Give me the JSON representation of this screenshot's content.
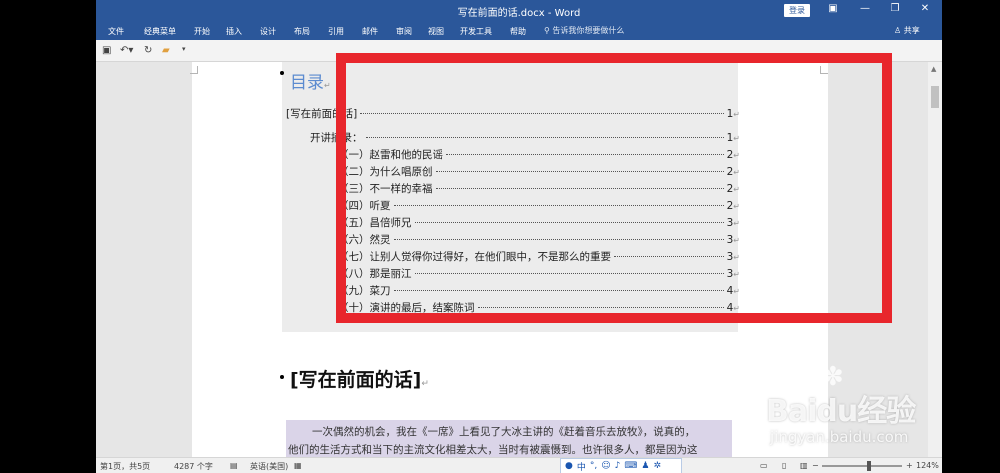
{
  "window": {
    "title": "写在前面的话.docx - Word",
    "login_label": "登录",
    "controls": [
      "▣",
      "—",
      "❐",
      "✕"
    ]
  },
  "menu": {
    "items": [
      "文件",
      "经典菜单",
      "开始",
      "插入",
      "设计",
      "布局",
      "引用",
      "邮件",
      "审阅",
      "视图",
      "开发工具",
      "帮助"
    ],
    "tell_me": "告诉我你想要做什么",
    "share": "共享"
  },
  "qat": {
    "icons": [
      "save-icon",
      "undo-icon",
      "redo-icon",
      "open-folder-icon",
      "customize-icon"
    ]
  },
  "toc": {
    "heading": "目录",
    "entries": [
      {
        "text": "[写在前面的话]",
        "page": "1",
        "level": 0
      },
      {
        "text": "开讲摘录：",
        "page": "1",
        "level": 1
      },
      {
        "text": "（一）赵雷和他的民谣",
        "page": "2",
        "level": 2
      },
      {
        "text": "（二）为什么唱原创",
        "page": "2",
        "level": 2
      },
      {
        "text": "（三）不一样的幸福",
        "page": "2",
        "level": 2
      },
      {
        "text": "（四）听夏",
        "page": "2",
        "level": 2
      },
      {
        "text": "（五）昌倍师兄",
        "page": "3",
        "level": 2
      },
      {
        "text": "（六）然灵",
        "page": "3",
        "level": 2
      },
      {
        "text": "（七）让别人觉得你过得好，在他们眼中，不是那么的重要",
        "page": "3",
        "level": 2
      },
      {
        "text": "（八）那是丽江",
        "page": "3",
        "level": 2
      },
      {
        "text": "（九）菜刀",
        "page": "4",
        "level": 2
      },
      {
        "text": "（十）演讲的最后，结案陈词",
        "page": "4",
        "level": 2
      }
    ]
  },
  "document": {
    "section_title": "[写在前面的话]",
    "paragraph_lines": [
      "一次偶然的机会，我在《一席》上看见了大冰主讲的《赶着音乐去放牧》，说真的，",
      "他们的生活方式和当下的主流文化相差太大，当时有被震慑到。也许很多人，都是因为这"
    ]
  },
  "status": {
    "page": "第1页，共5页",
    "words": "4287 个字",
    "language": "英语(美国)",
    "ime_label": "中",
    "zoom": "124%"
  },
  "watermark": {
    "brand": "Baidu经验",
    "url": "jingyan.baidu.com"
  }
}
